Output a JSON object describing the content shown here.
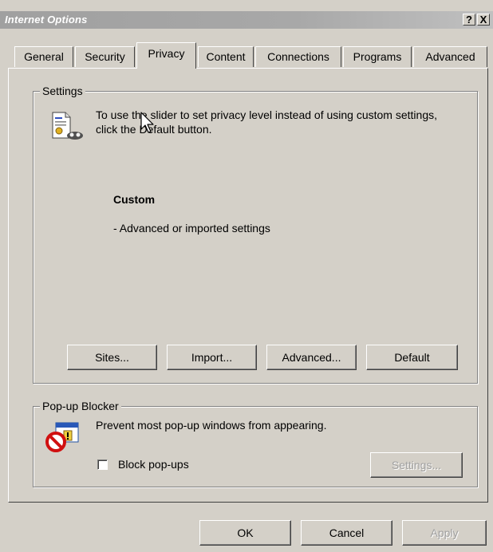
{
  "window": {
    "title": "Internet Options",
    "help_label": "?",
    "close_label": "X"
  },
  "tabs": [
    {
      "label": "General",
      "active": false
    },
    {
      "label": "Security",
      "active": false
    },
    {
      "label": "Privacy",
      "active": true
    },
    {
      "label": "Content",
      "active": false
    },
    {
      "label": "Connections",
      "active": false
    },
    {
      "label": "Programs",
      "active": false
    },
    {
      "label": "Advanced",
      "active": false
    }
  ],
  "settings": {
    "legend": "Settings",
    "description": "To use the slider to set privacy level instead of using custom settings, click the Default button.",
    "level_title": "Custom",
    "level_description": "- Advanced or imported settings",
    "buttons": {
      "sites": "Sites...",
      "import": "Import...",
      "advanced": "Advanced...",
      "default": "Default"
    },
    "icon": "privacy-certificate-icon"
  },
  "popup_blocker": {
    "legend": "Pop-up Blocker",
    "description": "Prevent most pop-up windows from appearing.",
    "checkbox_label": "Block pop-ups",
    "checkbox_checked": false,
    "settings_button": "Settings...",
    "icon": "popup-blocked-icon"
  },
  "footer": {
    "ok": "OK",
    "cancel": "Cancel",
    "apply": "Apply"
  },
  "colors": {
    "face": "#d4d0c8",
    "title_inactive": "#a0a0a0",
    "disabled_text": "#a0a0a0"
  }
}
